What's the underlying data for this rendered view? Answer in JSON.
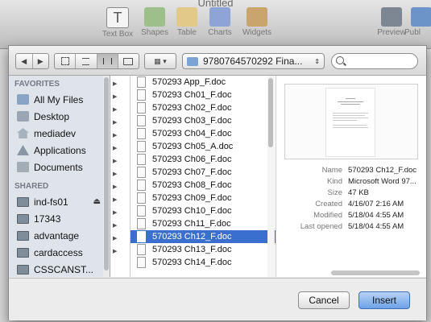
{
  "app": {
    "title": "Untitled",
    "toolbar": [
      {
        "label": "Text Box",
        "icon": "text-box-icon"
      },
      {
        "label": "Shapes",
        "icon": "shapes-icon"
      },
      {
        "label": "Table",
        "icon": "table-icon"
      },
      {
        "label": "Charts",
        "icon": "charts-icon"
      },
      {
        "label": "Widgets",
        "icon": "widgets-icon"
      },
      {
        "label": "Preview",
        "icon": "preview-icon"
      },
      {
        "label": "Publ",
        "icon": "publish-icon"
      }
    ]
  },
  "dialog": {
    "nav": {
      "back": "◀",
      "forward": "▶"
    },
    "path_popup": "9780764570292 Fina...",
    "search": {
      "value": "",
      "placeholder": ""
    },
    "sidebar": {
      "favorites_heading": "FAVORITES",
      "favorites": [
        {
          "label": "All My Files",
          "icon": "all-my-files-icon"
        },
        {
          "label": "Desktop",
          "icon": "desktop-icon"
        },
        {
          "label": "mediadev",
          "icon": "home-folder-icon"
        },
        {
          "label": "Applications",
          "icon": "applications-icon"
        },
        {
          "label": "Documents",
          "icon": "documents-icon"
        }
      ],
      "shared_heading": "SHARED",
      "shared": [
        {
          "label": "ind-fs01",
          "icon": "server-icon",
          "eject": "⏏"
        },
        {
          "label": "17343",
          "icon": "computer-icon"
        },
        {
          "label": "advantage",
          "icon": "computer-icon"
        },
        {
          "label": "cardaccess",
          "icon": "computer-icon"
        },
        {
          "label": "CSSCANST...",
          "icon": "computer-icon"
        }
      ]
    },
    "files": [
      "570293 App_F.doc",
      "570293 Ch01_F.doc",
      "570293 Ch02_F.doc",
      "570293 Ch03_F.doc",
      "570293 Ch04_F.doc",
      "570293 Ch05_A.doc",
      "570293 Ch06_F.doc",
      "570293 Ch07_F.doc",
      "570293 Ch08_F.doc",
      "570293 Ch09_F.doc",
      "570293 Ch10_F.doc",
      "570293 Ch11_F.doc",
      "570293 Ch12_F.doc",
      "570293 Ch13_F.doc",
      "570293 Ch14_F.doc"
    ],
    "selected_file": "570293 Ch12_F.doc",
    "preview": {
      "info": [
        {
          "key": "Name",
          "value": "570293 Ch12_F.doc"
        },
        {
          "key": "Kind",
          "value": "Microsoft Word 97..."
        },
        {
          "key": "Size",
          "value": "47 KB"
        },
        {
          "key": "Created",
          "value": "4/16/07 2:16 AM"
        },
        {
          "key": "Modified",
          "value": "5/18/04 4:55 AM"
        },
        {
          "key": "Last opened",
          "value": "5/18/04 4:55 AM"
        }
      ]
    },
    "buttons": {
      "cancel": "Cancel",
      "insert": "Insert"
    }
  }
}
